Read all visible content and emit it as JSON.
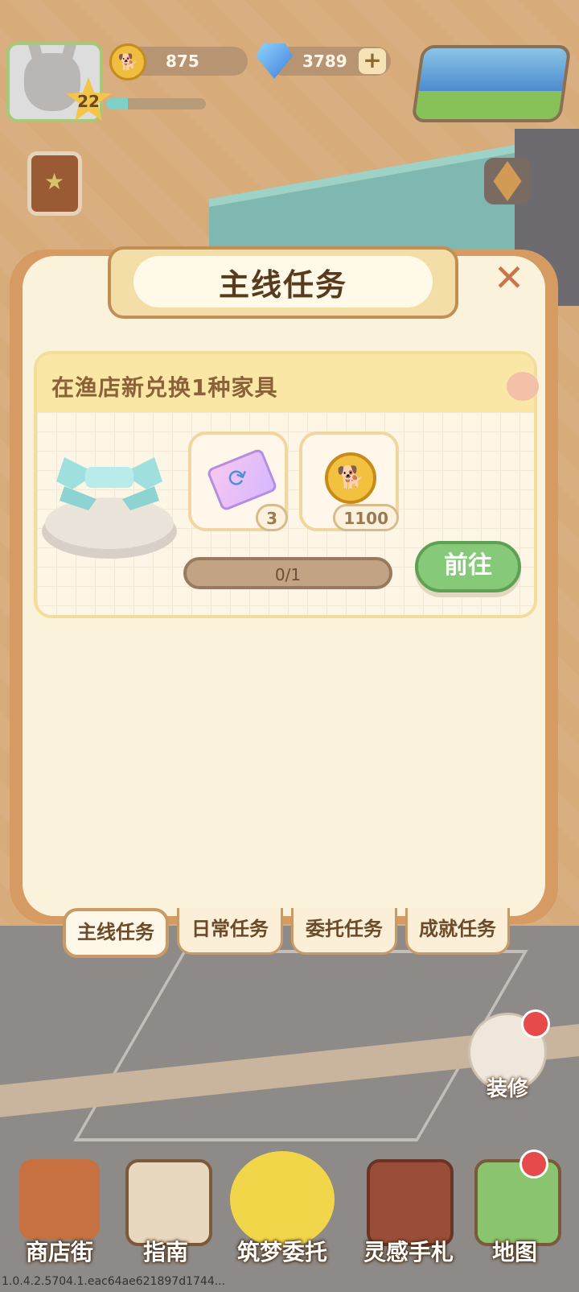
{
  "hud": {
    "level": "22",
    "xp_fraction": 0.22,
    "coins": "875",
    "gems": "3789",
    "plus": "+",
    "icons": [
      "rabbit-avatar",
      "coin-icon",
      "gem-icon",
      "plus-icon",
      "map-preview"
    ]
  },
  "panel": {
    "title": "主线任务",
    "close": "✕"
  },
  "task": {
    "title": "在渔店新兑换1种家具",
    "rewards": [
      {
        "icon": "exchange-ticket",
        "count": "3"
      },
      {
        "icon": "gold-coin",
        "count": "1100"
      }
    ],
    "progress_text": "0/1",
    "progress_fraction": 0,
    "go_button": "前往"
  },
  "tabs": [
    {
      "label": "主线任务",
      "active": true
    },
    {
      "label": "日常任务",
      "active": false
    },
    {
      "label": "委托任务",
      "active": false
    },
    {
      "label": "成就任务",
      "active": false
    }
  ],
  "side": {
    "decorate": "装修"
  },
  "nav": {
    "shop_street": "商店街",
    "guide": "指南",
    "dream_commission": "筑梦委托",
    "inspiration_notes": "灵感手札",
    "map": "地图"
  },
  "colors": {
    "panel_border": "#d69a63",
    "go_green": "#86c978",
    "notification_red": "#e64a4a"
  },
  "version": "1.0.4.2.5704.1.eac64ae621897d1744..."
}
